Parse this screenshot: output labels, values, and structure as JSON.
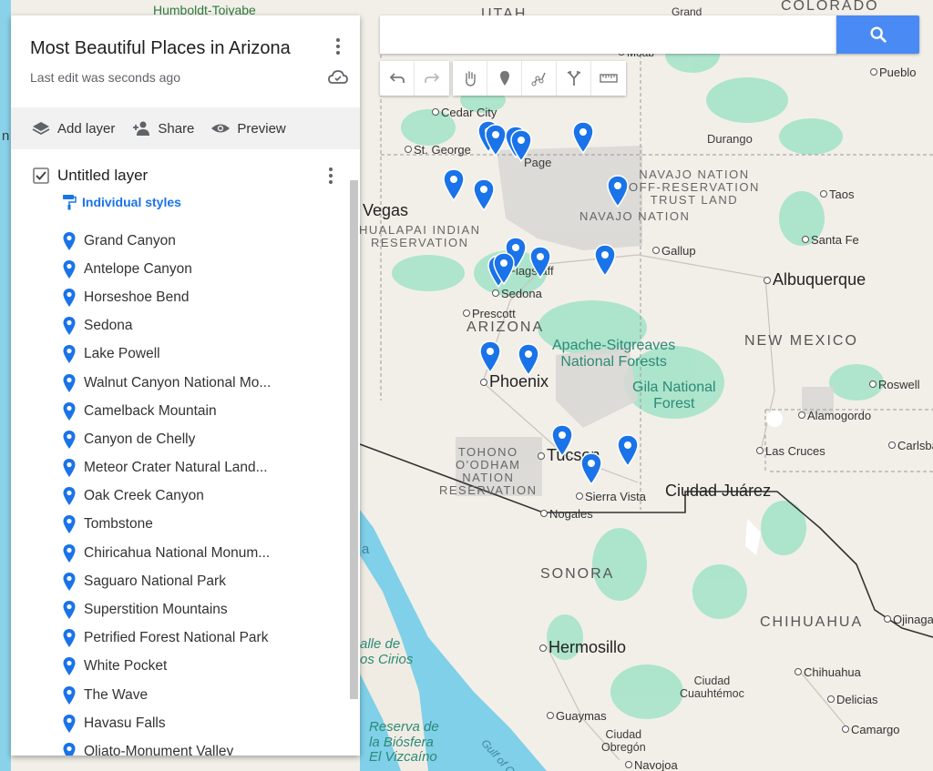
{
  "map_title": "Most Beautiful Places in Arizona",
  "edit_status": "Last edit was seconds ago",
  "actions": {
    "add_layer": "Add layer",
    "share": "Share",
    "preview": "Preview"
  },
  "layer": {
    "name": "Untitled layer",
    "checked": true,
    "style": "Individual styles"
  },
  "places": [
    "Grand Canyon",
    "Antelope Canyon",
    "Horseshoe Bend",
    "Sedona",
    "Lake Powell",
    "Walnut Canyon National Mo...",
    "Camelback Mountain",
    "Canyon de Chelly",
    "Meteor Crater Natural Land...",
    "Oak Creek Canyon",
    "Tombstone",
    "Chiricahua National Monum...",
    "Saguaro National Park",
    "Superstition Mountains",
    "Petrified Forest National Park",
    "White Pocket",
    "The Wave",
    "Havasu Falls",
    "Oljato-Monument Valley"
  ],
  "search": {
    "value": ""
  },
  "toolbar": [
    "undo-icon",
    "redo-icon",
    "pan-hand-icon",
    "add-marker-icon",
    "draw-line-icon",
    "directions-icon",
    "measure-ruler-icon"
  ],
  "colors": {
    "accent": "#4a8af4",
    "pin": "#1a73e8",
    "land": "#f2efe9",
    "water": "#7fd0e8",
    "forest": "#9be0c3"
  },
  "map_labels": {
    "humboldt": "Humboldt-Toiyabe",
    "utah": "UTAH",
    "grand": "Grand",
    "colorado": "COLORADO",
    "moab": "Moab",
    "pueblo": "Pueblo",
    "cedar_city": "Cedar City",
    "st_george": "St. George",
    "page": "Page",
    "durango": "Durango",
    "navajo_off": "NAVAJO NATION\nOFF-RESERVATION\nTRUST LAND",
    "navajo_nation": "NAVAJO NATION",
    "taos": "Taos",
    "vegas": "Vegas",
    "hualapai": "HUALAPAI INDIAN\nRESERVATION",
    "santa_fe": "Santa Fe",
    "gallup": "Gallup",
    "flagstaff": "Flagstaff",
    "albuquerque": "Albuquerque",
    "sedona": "Sedona",
    "prescott": "Prescott",
    "arizona": "ARIZONA",
    "apache": "Apache-Sitgreaves\nNational Forests",
    "new_mexico": "NEW MEXICO",
    "phoenix": "Phoenix",
    "gila": "Gila National\nForest",
    "roswell": "Roswell",
    "alamogordo": "Alamogordo",
    "tohono": "TOHONO\nO'ODHAM\nNATION\nRESERVATION",
    "tucson": "Tucson",
    "las_cruces": "Las Cruces",
    "carlsbad": "Carlsba",
    "sierra_vista": "Sierra Vista",
    "ciudad_juarez": "Ciudad Juárez",
    "nogales": "Nogales",
    "sonora": "SONORA",
    "chihuahua_state": "CHIHUAHUA",
    "ojinaga": "Ojinaga",
    "hermosillo": "Hermosillo",
    "valle_cirios": "alle de\nos Cirios",
    "chihuahua_city": "Chihuahua",
    "ciudad_cuauhtemoc": "Ciudad\nCuauhtémoc",
    "delicias": "Delicias",
    "guaymas": "Guaymas",
    "camargo": "Camargo",
    "reserva": "Reserva de\nla Biósfera\nEl Vizcaíno",
    "gulf": "Gulf of Cali",
    "ciudad_obregon": "Ciudad\nObregón",
    "navojoa": "Navojoa",
    "edge_a": "a",
    "edge_n": "n"
  }
}
